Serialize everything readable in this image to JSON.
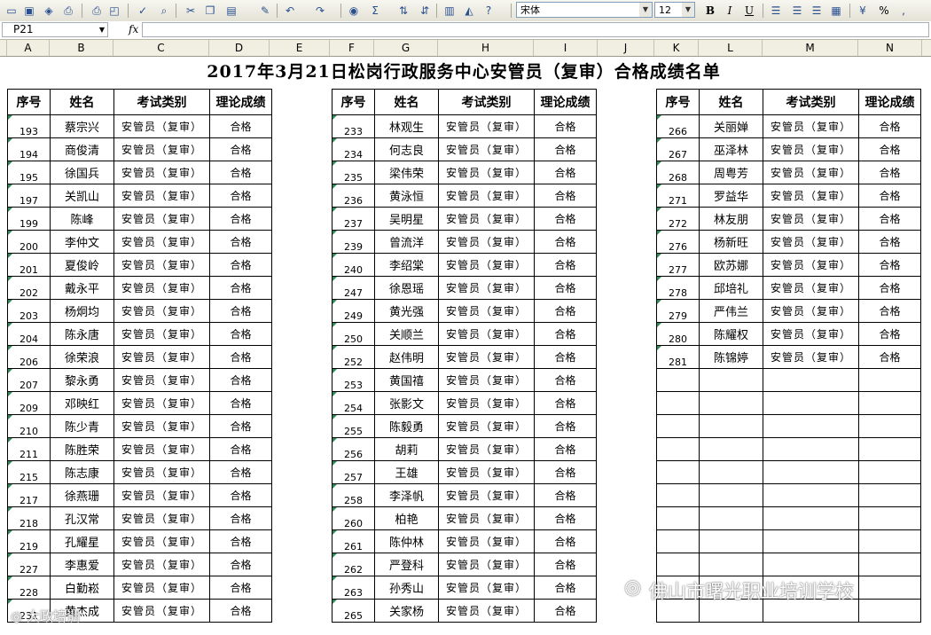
{
  "toolbar": {
    "font_name": "宋体",
    "font_size": "12",
    "bold_label": "B",
    "italic_label": "I",
    "underline_label": "U",
    "percent_label": "%",
    "sum_label": "Σ"
  },
  "formula_bar": {
    "cell_ref": "P21",
    "fx_label": "fx",
    "value": ""
  },
  "columns": [
    "A",
    "B",
    "C",
    "D",
    "E",
    "F",
    "G",
    "H",
    "I",
    "J",
    "K",
    "L",
    "M",
    "N"
  ],
  "sheet": {
    "title": "2017年3月21日松岗行政服务中心安管员（复审）合格成绩名单",
    "headers": [
      "序号",
      "姓名",
      "考试类别",
      "理论成绩"
    ],
    "blocks": [
      {
        "rows": [
          [
            "193",
            "蔡宗兴",
            "安管员（复审）",
            "合格"
          ],
          [
            "194",
            "商俊清",
            "安管员（复审）",
            "合格"
          ],
          [
            "195",
            "徐国兵",
            "安管员（复审）",
            "合格"
          ],
          [
            "197",
            "关凯山",
            "安管员（复审）",
            "合格"
          ],
          [
            "199",
            "陈峰",
            "安管员（复审）",
            "合格"
          ],
          [
            "200",
            "李仲文",
            "安管员（复审）",
            "合格"
          ],
          [
            "201",
            "夏俊岭",
            "安管员（复审）",
            "合格"
          ],
          [
            "202",
            "戴永平",
            "安管员（复审）",
            "合格"
          ],
          [
            "203",
            "杨炯均",
            "安管员（复审）",
            "合格"
          ],
          [
            "204",
            "陈永唐",
            "安管员（复审）",
            "合格"
          ],
          [
            "206",
            "徐荣浪",
            "安管员（复审）",
            "合格"
          ],
          [
            "207",
            "黎永勇",
            "安管员（复审）",
            "合格"
          ],
          [
            "209",
            "邓映红",
            "安管员（复审）",
            "合格"
          ],
          [
            "210",
            "陈少青",
            "安管员（复审）",
            "合格"
          ],
          [
            "211",
            "陈胜荣",
            "安管员（复审）",
            "合格"
          ],
          [
            "215",
            "陈志康",
            "安管员（复审）",
            "合格"
          ],
          [
            "217",
            "徐燕珊",
            "安管员（复审）",
            "合格"
          ],
          [
            "218",
            "孔汉常",
            "安管员（复审）",
            "合格"
          ],
          [
            "219",
            "孔耀星",
            "安管员（复审）",
            "合格"
          ],
          [
            "227",
            "李惠爱",
            "安管员（复审）",
            "合格"
          ],
          [
            "228",
            "白勤崧",
            "安管员（复审）",
            "合格"
          ],
          [
            "231",
            "黄杰成",
            "安管员（复审）",
            "合格"
          ]
        ]
      },
      {
        "rows": [
          [
            "233",
            "林观生",
            "安管员（复审）",
            "合格"
          ],
          [
            "234",
            "何志良",
            "安管员（复审）",
            "合格"
          ],
          [
            "235",
            "梁伟荣",
            "安管员（复审）",
            "合格"
          ],
          [
            "236",
            "黄泳恒",
            "安管员（复审）",
            "合格"
          ],
          [
            "237",
            "吴明星",
            "安管员（复审）",
            "合格"
          ],
          [
            "239",
            "曾流洋",
            "安管员（复审）",
            "合格"
          ],
          [
            "240",
            "李绍棠",
            "安管员（复审）",
            "合格"
          ],
          [
            "247",
            "徐恩瑶",
            "安管员（复审）",
            "合格"
          ],
          [
            "249",
            "黄光强",
            "安管员（复审）",
            "合格"
          ],
          [
            "250",
            "关顺兰",
            "安管员（复审）",
            "合格"
          ],
          [
            "252",
            "赵伟明",
            "安管员（复审）",
            "合格"
          ],
          [
            "253",
            "黄国禧",
            "安管员（复审）",
            "合格"
          ],
          [
            "254",
            "张影文",
            "安管员（复审）",
            "合格"
          ],
          [
            "255",
            "陈毅勇",
            "安管员（复审）",
            "合格"
          ],
          [
            "256",
            "胡莉",
            "安管员（复审）",
            "合格"
          ],
          [
            "257",
            "王雄",
            "安管员（复审）",
            "合格"
          ],
          [
            "258",
            "李泽帆",
            "安管员（复审）",
            "合格"
          ],
          [
            "260",
            "柏艳",
            "安管员（复审）",
            "合格"
          ],
          [
            "261",
            "陈仲林",
            "安管员（复审）",
            "合格"
          ],
          [
            "262",
            "严登科",
            "安管员（复审）",
            "合格"
          ],
          [
            "263",
            "孙秀山",
            "安管员（复审）",
            "合格"
          ],
          [
            "265",
            "关家杨",
            "安管员（复审）",
            "合格"
          ]
        ]
      },
      {
        "rows": [
          [
            "266",
            "关丽婵",
            "安管员（复审）",
            "合格"
          ],
          [
            "267",
            "巫泽林",
            "安管员（复审）",
            "合格"
          ],
          [
            "268",
            "周粤芳",
            "安管员（复审）",
            "合格"
          ],
          [
            "271",
            "罗益华",
            "安管员（复审）",
            "合格"
          ],
          [
            "272",
            "林友朋",
            "安管员（复审）",
            "合格"
          ],
          [
            "276",
            "杨新旺",
            "安管员（复审）",
            "合格"
          ],
          [
            "277",
            "欧苏娜",
            "安管员（复审）",
            "合格"
          ],
          [
            "278",
            "邱培礼",
            "安管员（复审）",
            "合格"
          ],
          [
            "279",
            "严伟兰",
            "安管员（复审）",
            "合格"
          ],
          [
            "280",
            "陈耀权",
            "安管员（复审）",
            "合格"
          ],
          [
            "281",
            "陈锦婷",
            "安管员（复审）",
            "合格"
          ]
        ]
      }
    ]
  },
  "watermarks": {
    "right": "佛山市曙光职业培训学校",
    "left": "大政培训"
  }
}
